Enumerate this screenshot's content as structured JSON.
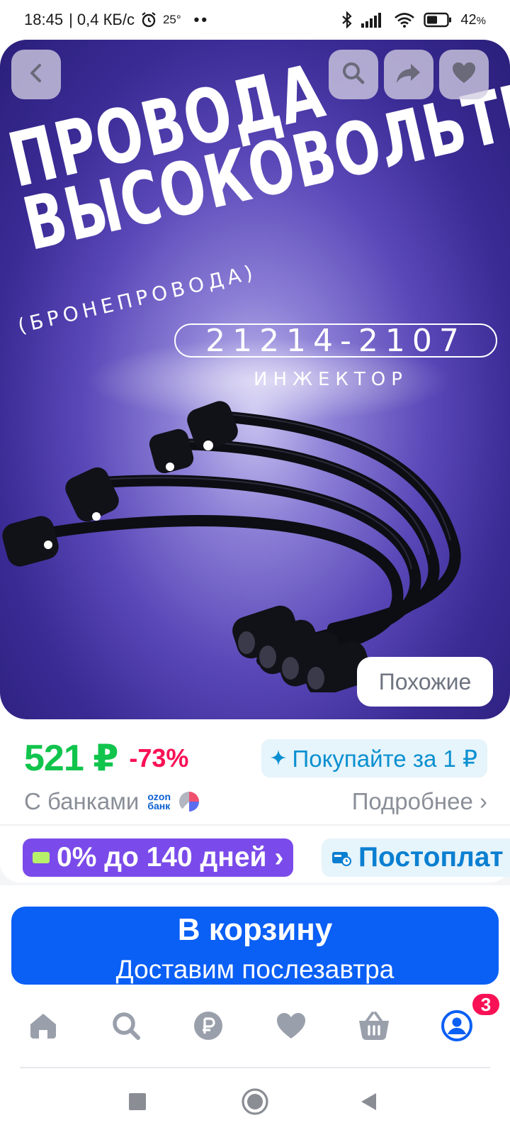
{
  "status_bar": {
    "time": "18:45",
    "speed": "| 0,4 КБ/с",
    "temperature": "25°",
    "dots": "••",
    "battery": "42",
    "battery_unit": "%",
    "icons": [
      "alarm-icon",
      "bluetooth-icon",
      "signal-icon",
      "wifi-icon",
      "battery-icon"
    ]
  },
  "hero": {
    "title_line1": "ПРОВОДА",
    "title_line2": "ВЫСОКОВОЛЬТНЫЕ",
    "subtitle": "(БРОНЕПРОВОДА)",
    "model": "21214-2107",
    "engine_type": "ИНЖЕКТОР",
    "background_color": "#3a2b95",
    "buttons": [
      "back-icon",
      "search-icon",
      "share-icon",
      "heart-icon"
    ],
    "similar_label": "Похожие"
  },
  "price": {
    "value": "521 ₽",
    "discount": "-73%",
    "buy_for_one": "Покупайте за 1 ₽",
    "banks_label": "С банками",
    "bank_logo_line1": "ozon",
    "bank_logo_line2": "банк",
    "details_label": "Подробнее ›",
    "price_color": "#10c44c",
    "discount_color": "#f91155"
  },
  "promo": {
    "installment": "0% до 140 дней ›",
    "postpay": "Постоплат",
    "installment_color": "#7a4bea"
  },
  "cart": {
    "label": "В корзину",
    "sublabel": "Доставим послезавтра",
    "color": "#0a5ff5"
  },
  "bottom_nav": {
    "items": [
      "home-icon",
      "search-icon",
      "ruble-icon",
      "favorites-icon",
      "cart-icon",
      "profile-icon"
    ],
    "badge": "3",
    "active_color": "#0a5ff5",
    "inactive_color": "#9aa0ab"
  },
  "system_nav": {
    "items": [
      "recents-icon",
      "home-icon",
      "back-icon"
    ]
  }
}
